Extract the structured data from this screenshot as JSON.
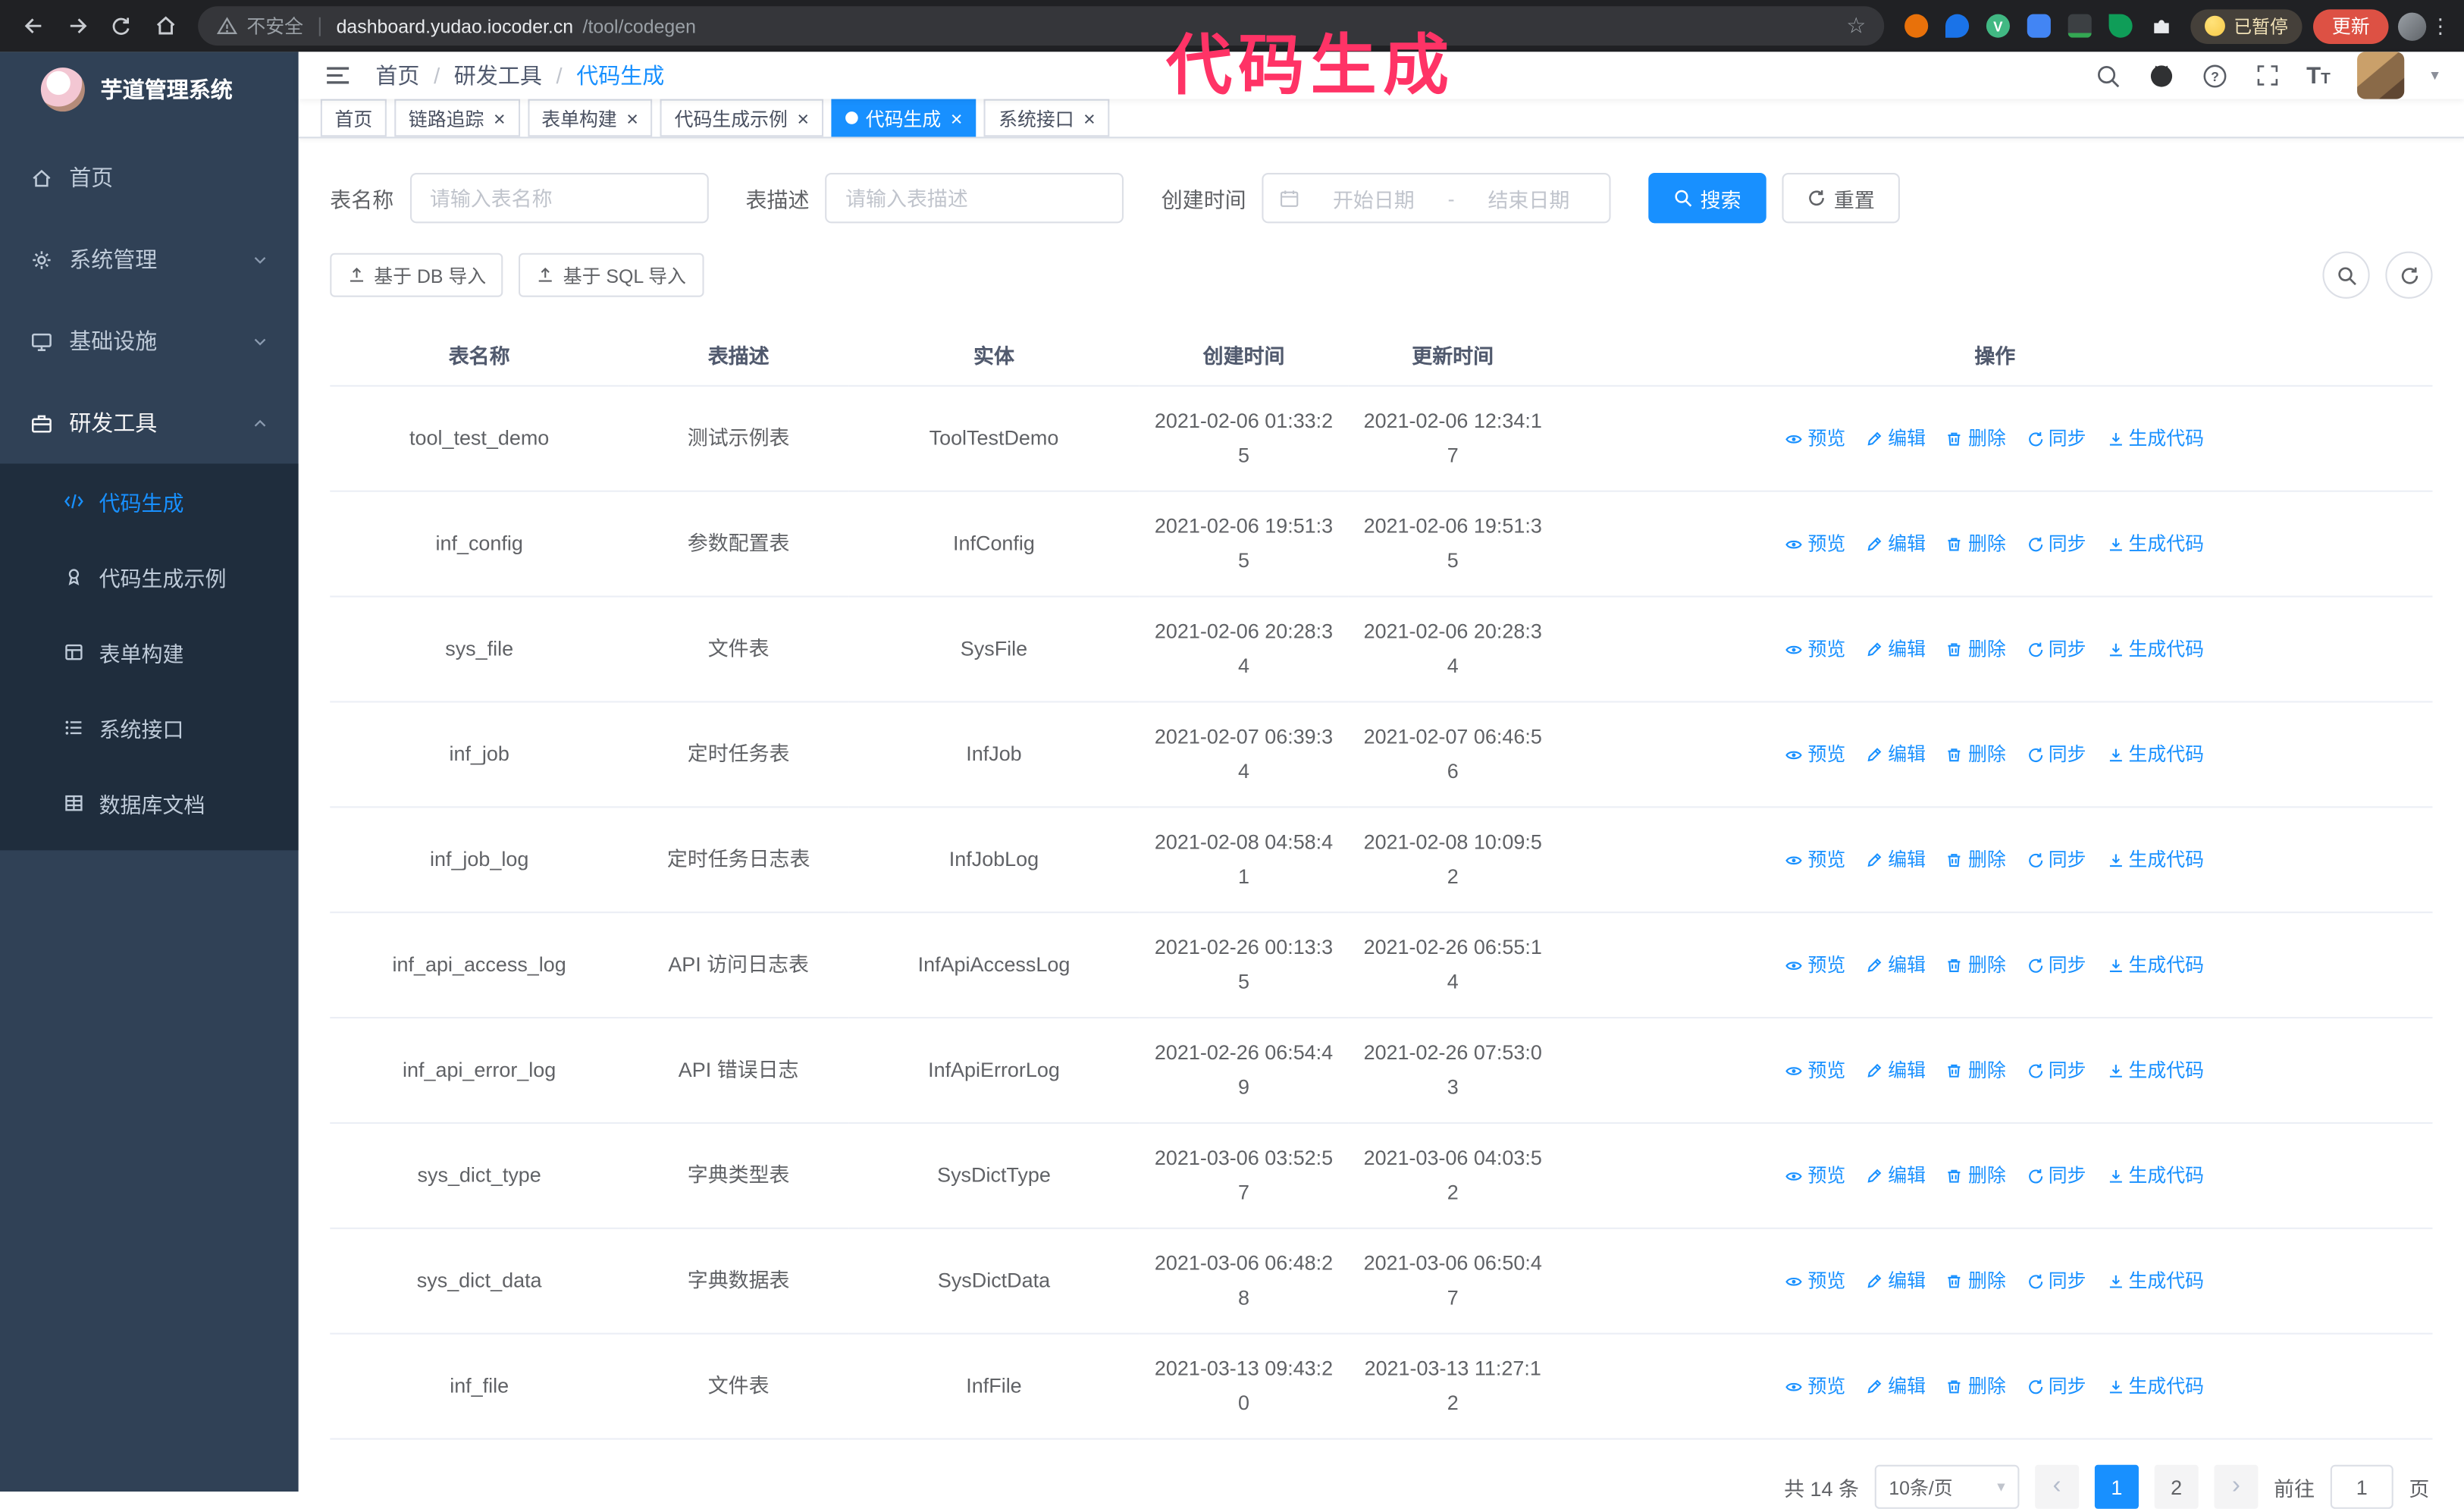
{
  "colors": {
    "accent": "#1890ff",
    "sidebar_bg": "#304156",
    "submenu_bg": "#1f2d3d",
    "annotation": "#ff3366",
    "update_button_bg": "#dd5144",
    "active_tab_bg": "#1890ff"
  },
  "annotation": {
    "text": "代码生成"
  },
  "browser": {
    "security_label": "不安全",
    "url_host": "dashboard.yudao.iocoder.cn",
    "url_path": "/tool/codegen",
    "paused_badge": "已暂停",
    "update_button": "更新"
  },
  "sidebar": {
    "logo_title": "芋道管理系统",
    "items": [
      {
        "label": "首页"
      },
      {
        "label": "系统管理"
      },
      {
        "label": "基础设施"
      },
      {
        "label": "研发工具"
      }
    ],
    "submenu": [
      {
        "label": "代码生成"
      },
      {
        "label": "代码生成示例"
      },
      {
        "label": "表单构建"
      },
      {
        "label": "系统接口"
      },
      {
        "label": "数据库文档"
      }
    ]
  },
  "header": {
    "breadcrumb": [
      "首页",
      "研发工具",
      "代码生成"
    ]
  },
  "tabs": [
    {
      "label": "首页"
    },
    {
      "label": "链路追踪"
    },
    {
      "label": "表单构建"
    },
    {
      "label": "代码生成示例"
    },
    {
      "label": "代码生成"
    },
    {
      "label": "系统接口"
    }
  ],
  "filters": {
    "table_name_label": "表名称",
    "table_name_placeholder": "请输入表名称",
    "table_desc_label": "表描述",
    "table_desc_placeholder": "请输入表描述",
    "create_time_label": "创建时间",
    "date_start_placeholder": "开始日期",
    "date_separator": "-",
    "date_end_placeholder": "结束日期",
    "search_button": "搜索",
    "reset_button": "重置"
  },
  "toolbar": {
    "import_db_button": "基于 DB 导入",
    "import_sql_button": "基于 SQL 导入"
  },
  "table": {
    "columns": [
      "表名称",
      "表描述",
      "实体",
      "创建时间",
      "更新时间",
      "操作"
    ],
    "actions": [
      "预览",
      "编辑",
      "删除",
      "同步",
      "生成代码"
    ],
    "rows": [
      {
        "name": "tool_test_demo",
        "desc": "测试示例表",
        "entity": "ToolTestDemo",
        "created": "2021-02-06 01:33:25",
        "updated": "2021-02-06 12:34:17"
      },
      {
        "name": "inf_config",
        "desc": "参数配置表",
        "entity": "InfConfig",
        "created": "2021-02-06 19:51:35",
        "updated": "2021-02-06 19:51:35"
      },
      {
        "name": "sys_file",
        "desc": "文件表",
        "entity": "SysFile",
        "created": "2021-02-06 20:28:34",
        "updated": "2021-02-06 20:28:34"
      },
      {
        "name": "inf_job",
        "desc": "定时任务表",
        "entity": "InfJob",
        "created": "2021-02-07 06:39:34",
        "updated": "2021-02-07 06:46:56"
      },
      {
        "name": "inf_job_log",
        "desc": "定时任务日志表",
        "entity": "InfJobLog",
        "created": "2021-02-08 04:58:41",
        "updated": "2021-02-08 10:09:52"
      },
      {
        "name": "inf_api_access_log",
        "desc": "API 访问日志表",
        "entity": "InfApiAccessLog",
        "created": "2021-02-26 00:13:35",
        "updated": "2021-02-26 06:55:14"
      },
      {
        "name": "inf_api_error_log",
        "desc": "API 错误日志",
        "entity": "InfApiErrorLog",
        "created": "2021-02-26 06:54:49",
        "updated": "2021-02-26 07:53:03"
      },
      {
        "name": "sys_dict_type",
        "desc": "字典类型表",
        "entity": "SysDictType",
        "created": "2021-03-06 03:52:57",
        "updated": "2021-03-06 04:03:52"
      },
      {
        "name": "sys_dict_data",
        "desc": "字典数据表",
        "entity": "SysDictData",
        "created": "2021-03-06 06:48:28",
        "updated": "2021-03-06 06:50:47"
      },
      {
        "name": "inf_file",
        "desc": "文件表",
        "entity": "InfFile",
        "created": "2021-03-13 09:43:20",
        "updated": "2021-03-13 11:27:12"
      }
    ]
  },
  "pagination": {
    "total": "共 14 条",
    "page_size": "10条/页",
    "pages": [
      "1",
      "2"
    ],
    "current_page": "1",
    "goto_label": "前往",
    "goto_value": "1",
    "page_suffix": "页"
  }
}
